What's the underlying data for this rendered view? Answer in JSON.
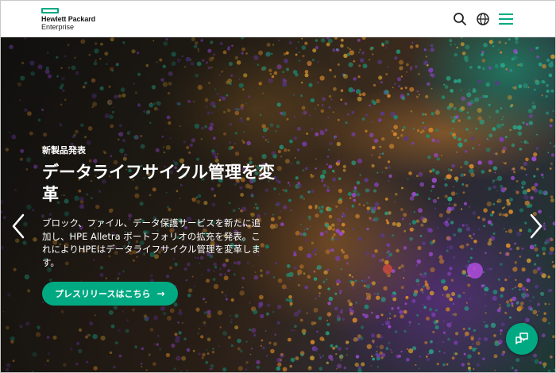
{
  "brand": {
    "line1": "Hewlett Packard",
    "line2": "Enterprise",
    "accent": "#01a982"
  },
  "header": {
    "icons": [
      "search-icon",
      "globe-icon",
      "menu-icon"
    ]
  },
  "hero": {
    "eyebrow": "新製品発表",
    "headline": "データライフサイクル管理を変革",
    "description": "ブロック、ファイル、データ保護サービスを新たに追加し、HPE Alletra ポートフォリオの拡充を発表。これによりHPEはデータライフサイクル管理を変革します。",
    "cta_label": "プレスリリースはこちら",
    "cta_arrow": "→",
    "prev_icon": "chevron-left-icon",
    "next_icon": "chevron-right-icon"
  },
  "chat": {
    "icon": "chat-icon"
  }
}
